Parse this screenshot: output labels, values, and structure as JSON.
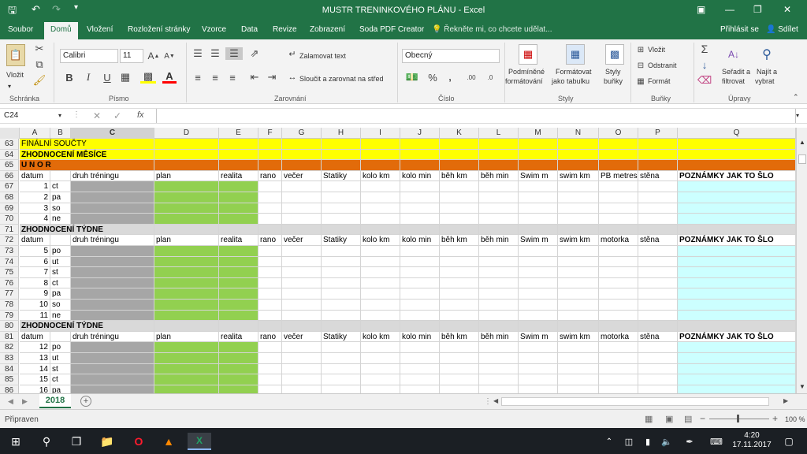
{
  "window": {
    "title": "MUSTR TRENINKOVÉHO PLÁNU - Excel"
  },
  "tabs": [
    "Soubor",
    "Domů",
    "Vložení",
    "Rozložení stránky",
    "Vzorce",
    "Data",
    "Revize",
    "Zobrazení",
    "Soda PDF Creator"
  ],
  "tell_me": "Řekněte mi, co chcete udělat...",
  "signin": "Přihlásit se",
  "share": "Sdílet",
  "ribbon": {
    "paste": "Vložit",
    "clipboard": "Schránka",
    "font_name": "Calibri",
    "font_size": "11",
    "font_group": "Písmo",
    "wrap": "Zalamovat text",
    "merge": "Sloučit a zarovnat na střed",
    "align_group": "Zarovnání",
    "number_format": "Obecný",
    "number_group": "Číslo",
    "cond_format_1": "Podmíněné",
    "cond_format_2": "formátování",
    "table_format_1": "Formátovat",
    "table_format_2": "jako tabulku",
    "cell_styles_1": "Styly",
    "cell_styles_2": "buňky",
    "styles_group": "Styly",
    "insert": "Vložit",
    "delete": "Odstranit",
    "format": "Formát",
    "cells_group": "Buňky",
    "sort_1": "Seřadit a",
    "sort_2": "filtrovat",
    "find_1": "Najít a",
    "find_2": "vybrat",
    "edit_group": "Úpravy"
  },
  "formula_bar": {
    "name_box": "C24",
    "fx": "fx",
    "value": ""
  },
  "columns": [
    "A",
    "B",
    "C",
    "D",
    "E",
    "F",
    "G",
    "H",
    "I",
    "J",
    "K",
    "L",
    "M",
    "N",
    "O",
    "P",
    "Q"
  ],
  "rows": [
    {
      "n": "63",
      "type": "yellow",
      "text": "FINÁLNÍ SOUČTY"
    },
    {
      "n": "64",
      "type": "yellow",
      "text": "ZHODNOCENÍ MĚSÍCE",
      "bold": true
    },
    {
      "n": "65",
      "type": "orange",
      "text": "U    N    O    R"
    },
    {
      "n": "66",
      "type": "header"
    },
    {
      "n": "67",
      "type": "data",
      "a": "1",
      "b": "ct"
    },
    {
      "n": "68",
      "type": "data",
      "a": "2",
      "b": "pa"
    },
    {
      "n": "69",
      "type": "data",
      "a": "3",
      "b": "so"
    },
    {
      "n": "70",
      "type": "data",
      "a": "4",
      "b": "ne"
    },
    {
      "n": "71",
      "type": "week",
      "text": "ZHODNOCENÍ TÝDNE"
    },
    {
      "n": "72",
      "type": "header2"
    },
    {
      "n": "73",
      "type": "data",
      "a": "5",
      "b": "po"
    },
    {
      "n": "74",
      "type": "data",
      "a": "6",
      "b": "ut"
    },
    {
      "n": "75",
      "type": "data",
      "a": "7",
      "b": "st"
    },
    {
      "n": "76",
      "type": "data",
      "a": "8",
      "b": "ct"
    },
    {
      "n": "77",
      "type": "data",
      "a": "9",
      "b": "pa"
    },
    {
      "n": "78",
      "type": "data",
      "a": "10",
      "b": "so"
    },
    {
      "n": "79",
      "type": "data",
      "a": "11",
      "b": "ne"
    },
    {
      "n": "80",
      "type": "week",
      "text": "ZHODNOCENÍ TÝDNE"
    },
    {
      "n": "81",
      "type": "header2"
    },
    {
      "n": "82",
      "type": "data",
      "a": "12",
      "b": "po"
    },
    {
      "n": "83",
      "type": "data",
      "a": "13",
      "b": "ut"
    },
    {
      "n": "84",
      "type": "data",
      "a": "14",
      "b": "st"
    },
    {
      "n": "85",
      "type": "data",
      "a": "15",
      "b": "ct"
    },
    {
      "n": "86",
      "type": "data",
      "a": "16",
      "b": "pa"
    }
  ],
  "header_labels": [
    "datum",
    "",
    "druh tréningu",
    "plan",
    "realita",
    "rano",
    "večer",
    "Statiky",
    "kolo km",
    "kolo min",
    "běh km",
    "běh min",
    "Swim m",
    "swim km",
    "PB metres",
    "stěna",
    "POZNÁMKY JAK TO ŠLO"
  ],
  "header2_labels": [
    "datum",
    "",
    "druh tréningu",
    "plan",
    "realita",
    "rano",
    "večer",
    "Statiky",
    "kolo km",
    "kolo min",
    "běh km",
    "běh min",
    "Swim m",
    "swim km",
    "motorka",
    "stěna",
    "POZNÁMKY JAK TO ŠLO"
  ],
  "sheet_tab": "2018",
  "status": {
    "ready": "Připraven",
    "zoom": "100 %"
  },
  "clock": {
    "time": "4:20",
    "date": "17.11.2017"
  },
  "colors": {
    "excel_green": "#217346",
    "yellow": "#ffff00",
    "orange": "#e26b0a",
    "gray": "#a6a6a6",
    "green": "#92d050",
    "light_blue": "#ccffff",
    "week_gray": "#d9d9d9"
  }
}
